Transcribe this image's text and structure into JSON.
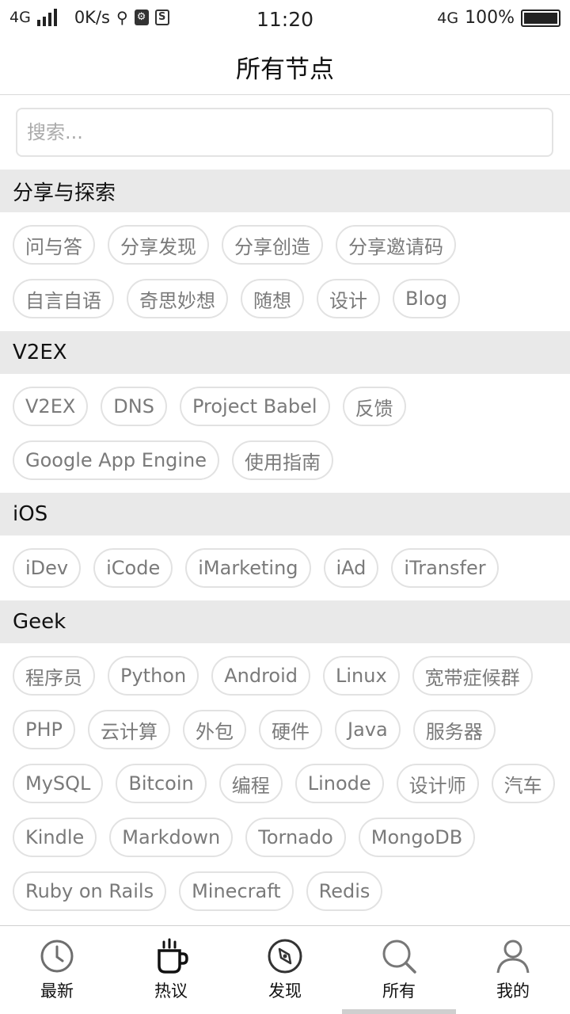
{
  "status_bar": {
    "network": "4G",
    "speed": "0K/s",
    "usb_icon": "usb-icon",
    "time": "11:20",
    "network_right": "4G",
    "battery": "100%"
  },
  "header": {
    "title": "所有节点"
  },
  "search": {
    "placeholder": "搜索..."
  },
  "sections": [
    {
      "title": "分享与探索",
      "tags": [
        "问与答",
        "分享发现",
        "分享创造",
        "分享邀请码",
        "自言自语",
        "奇思妙想",
        "随想",
        "设计",
        "Blog"
      ]
    },
    {
      "title": "V2EX",
      "tags": [
        "V2EX",
        "DNS",
        "Project Babel",
        "反馈",
        "Google App Engine",
        "使用指南"
      ]
    },
    {
      "title": "iOS",
      "tags": [
        "iDev",
        "iCode",
        "iMarketing",
        "iAd",
        "iTransfer"
      ]
    },
    {
      "title": "Geek",
      "tags": [
        "程序员",
        "Python",
        "Android",
        "Linux",
        "宽带症候群",
        "PHP",
        "云计算",
        "外包",
        "硬件",
        "Java",
        "服务器",
        "MySQL",
        "Bitcoin",
        "编程",
        "Linode",
        "设计师",
        "汽车",
        "Kindle",
        "Markdown",
        "Tornado",
        "MongoDB",
        "Ruby on Rails",
        "Minecraft",
        "Redis"
      ]
    }
  ],
  "tabbar": {
    "items": [
      {
        "label": "最新",
        "icon": "clock-icon"
      },
      {
        "label": "热议",
        "icon": "coffee-cup-icon"
      },
      {
        "label": "发现",
        "icon": "compass-icon"
      },
      {
        "label": "所有",
        "icon": "search-icon"
      },
      {
        "label": "我的",
        "icon": "user-icon"
      }
    ],
    "active_index": 3
  }
}
